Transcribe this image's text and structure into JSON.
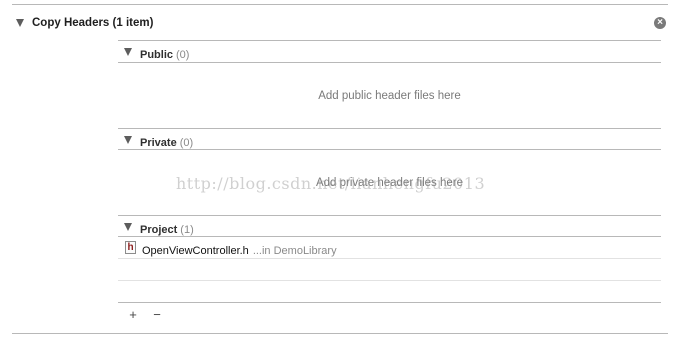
{
  "phase": {
    "title": "Copy Headers (1 item)",
    "remove_icon": "remove-circle-icon"
  },
  "groups": {
    "public": {
      "title": "Public",
      "count": "(0)",
      "placeholder": "Add public header files here"
    },
    "private": {
      "title": "Private",
      "count": "(0)",
      "placeholder": "Add private header files here"
    },
    "project": {
      "title": "Project",
      "count": "(1)",
      "files": [
        {
          "icon": "h",
          "name": "OpenViewController.h",
          "location": "...in DemoLibrary"
        }
      ]
    }
  },
  "toolbar": {
    "add_label": "+",
    "remove_label": "−"
  },
  "watermark": "http://blog.csdn.net/lianhengfu2013"
}
